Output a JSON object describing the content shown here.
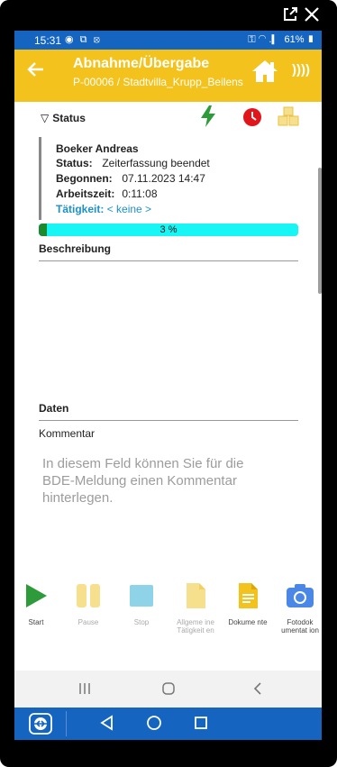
{
  "statusbar": {
    "time": "15:31",
    "left_icons": "◉ ⧉ ⦻",
    "right_icons": "⚿ ◠ .▎ 61% ▮"
  },
  "appbar": {
    "title": "Abnahme/Übergabe",
    "subtitle": "P-00006 / Stadtvilla_Krupp_Beilens",
    "back_icon": "arrow-left-icon",
    "nfc_label": "))))"
  },
  "status_section": {
    "toggle": "▽",
    "title": "Status"
  },
  "status_icons": [
    {
      "name": "bolt-icon",
      "color": "#2e9b3a"
    },
    {
      "name": "clock-icon",
      "color": "#e0161b"
    },
    {
      "name": "boxes-icon",
      "color": "#f7d774"
    }
  ],
  "entry": {
    "name": "Boeker Andreas",
    "status_key": "Status:",
    "status_val": "Zeiterfassung beendet",
    "begun_key": "Begonnen:",
    "begun_val": "07.11.2023 14:47",
    "worktime_key": "Arbeitszeit:",
    "worktime_val": "0:11:08",
    "activity_key": "Tätigkeit:",
    "activity_val": "< keine >"
  },
  "progress": {
    "label": "3 %",
    "value": 0.03
  },
  "beschreibung": {
    "title": "Beschreibung"
  },
  "daten": {
    "title": "Daten"
  },
  "kommentar": {
    "label": "Kommentar",
    "placeholder": "In diesem Feld können Sie für die BDE-Meldung einen Kommentar hinterlegen."
  },
  "toolbar": [
    {
      "key": "start",
      "label": "Start",
      "icon": "play-icon",
      "active": true
    },
    {
      "key": "pause",
      "label": "Pause",
      "icon": "pause-icon",
      "active": false
    },
    {
      "key": "stop",
      "label": "Stop",
      "icon": "stop-icon",
      "active": false
    },
    {
      "key": "allg",
      "label": "Allgeme ine Tätigkeit en",
      "icon": "document-icon",
      "active": false
    },
    {
      "key": "doku",
      "label": "Dokume nte",
      "icon": "document-icon",
      "active": true
    },
    {
      "key": "foto",
      "label": "Fotodok umentat ion",
      "icon": "camera-icon",
      "active": true
    }
  ],
  "colors": {
    "accent": "#f4c21c",
    "brand": "#1565c0",
    "progress_bg": "#17f5f5",
    "progress_fill": "#1b8a2e",
    "link": "#1e90c8"
  }
}
